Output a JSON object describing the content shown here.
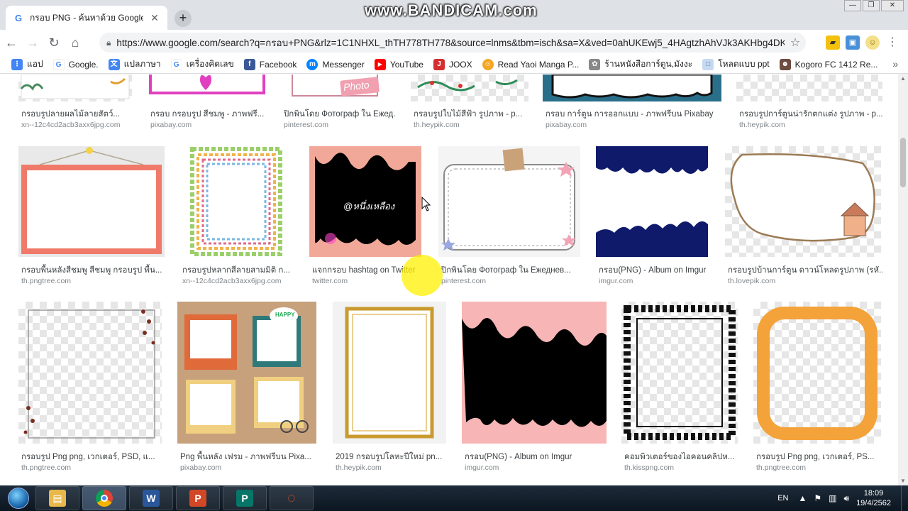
{
  "browser": {
    "tab_title": "กรอบ PNG - ค้นหาด้วย Google",
    "tab_favicon": "G",
    "new_tab_label": "+",
    "watermark": "www.BANDICAM.com",
    "url": "https://www.google.com/search?q=กรอบ+PNG&rlz=1C1NHXL_thTH778TH778&source=lnms&tbm=isch&sa=X&ved=0ahUKEwj5_4HAgtzhAhVJk3AKHbg4DKo...",
    "window_controls": [
      "—",
      "❐",
      "✕"
    ]
  },
  "bookmarks": [
    {
      "label": "แอป",
      "icon": "apps-icon",
      "color": "#4285f4",
      "glyph": "⋮"
    },
    {
      "label": "Google.",
      "icon": "google-icon",
      "color": "#ffffff",
      "glyph": "G"
    },
    {
      "label": "แปลภาษา",
      "icon": "translate-icon",
      "color": "#4285f4",
      "glyph": "文"
    },
    {
      "label": "เครื่องคิดเลข",
      "icon": "google-icon",
      "color": "#ffffff",
      "glyph": "G"
    },
    {
      "label": "Facebook",
      "icon": "facebook-icon",
      "color": "#3b5998",
      "glyph": "f"
    },
    {
      "label": "Messenger",
      "icon": "messenger-icon",
      "color": "#0084ff",
      "glyph": "m"
    },
    {
      "label": "YouTube",
      "icon": "youtube-icon",
      "color": "#ff0000",
      "glyph": "▶"
    },
    {
      "label": "JOOX",
      "icon": "joox-icon",
      "color": "#d32f2f",
      "glyph": "J"
    },
    {
      "label": "Read Yaoi Manga P...",
      "icon": "manga-icon",
      "color": "#f5a623",
      "glyph": "☺"
    },
    {
      "label": "ร้านหนังสือการ์ตูน,มังงะ",
      "icon": "bookstore-icon",
      "color": "#888888",
      "glyph": "✿"
    },
    {
      "label": "โหลดแบบ ppt",
      "icon": "page-icon",
      "color": "#c5d9f1",
      "glyph": "□"
    },
    {
      "label": "Kogoro FC 1412 Re...",
      "icon": "avatar-icon",
      "color": "#6d4c41",
      "glyph": "☻"
    }
  ],
  "results": {
    "row1": [
      {
        "caption": "กรอบรูปลายผลไม้ลายสัตว์...",
        "source": "xn--12c4cd2acb3axx6jpg.com"
      },
      {
        "caption": "กรอบ กรอบรูป สีชมพู - ภาพฟรี...",
        "source": "pixabay.com"
      },
      {
        "caption": "ปิกพินโดย Фотограф ใน Ежед...",
        "source": "pinterest.com"
      },
      {
        "caption": "กรอบรูปใบไม้สีฟ้า รูปภาพ - p...",
        "source": "th.heypik.com"
      },
      {
        "caption": "กรอบ การ์ตูน การออกแบบ - ภาพฟรีบน Pixabay",
        "source": "pixabay.com"
      },
      {
        "caption": "กรอบรูปการ์ตูนน่ารักตกแต่ง รูปภาพ - p...",
        "source": "th.heypik.com"
      }
    ],
    "row2": [
      {
        "caption": "กรอบพื้นหลังสีชมพู สีชมพู กรอบรูป พื้น...",
        "source": "th.pngtree.com"
      },
      {
        "caption": "กรอบรูปหลากสีลายสามมิติ ก...",
        "source": "xn--12c4cd2acb3axx6jpg.com"
      },
      {
        "caption": "แจกกรอบ hashtag on Twitter",
        "source": "twitter.com"
      },
      {
        "caption": "ปิกพินโดย Фотограф ใน Ежеднев...",
        "source": "pinterest.com"
      },
      {
        "caption": "กรอบ(PNG) - Album on Imgur",
        "source": "imgur.com"
      },
      {
        "caption": "กรอบรูปบ้านการ์ตูน ดาวน์โหลดรูปภาพ (รหั...",
        "source": "th.lovepik.com"
      }
    ],
    "row3": [
      {
        "caption": "กรอบรูป Png png, เวกเตอร์, PSD, แ...",
        "source": "th.pngtree.com"
      },
      {
        "caption": "Png พื้นหลัง เฟรม - ภาพฟรีบน Pixa...",
        "source": "pixabay.com"
      },
      {
        "caption": "2019 กรอบรูปโลหะปีใหม่ pn...",
        "source": "th.heypik.com"
      },
      {
        "caption": "กรอบ(PNG) - Album on Imgur",
        "source": "imgur.com"
      },
      {
        "caption": "คอมพิวเตอร์ของไอคอนคลิปห...",
        "source": "th.kisspng.com"
      },
      {
        "caption": "กรอบรูป Png png, เวกเตอร์, PS...",
        "source": "th.pngtree.com"
      }
    ],
    "thumb_text": {
      "photo_label": "Photo",
      "hashtag_label": "@หนึ่งเหลือง",
      "happy_label": "HAPPY"
    }
  },
  "taskbar": {
    "apps": [
      {
        "name": "file-explorer",
        "glyph": "▤",
        "color": "#e8b84a"
      },
      {
        "name": "chrome",
        "glyph": "◉",
        "color": "#db4437"
      },
      {
        "name": "word",
        "glyph": "W",
        "color": "#2b579a"
      },
      {
        "name": "powerpoint",
        "glyph": "P",
        "color": "#d24726"
      },
      {
        "name": "publisher",
        "glyph": "P",
        "color": "#077568"
      },
      {
        "name": "bandicam",
        "glyph": "◌",
        "color": "#e05a2b"
      }
    ],
    "language": "EN",
    "time": "18:09",
    "date": "19/4/2562"
  }
}
